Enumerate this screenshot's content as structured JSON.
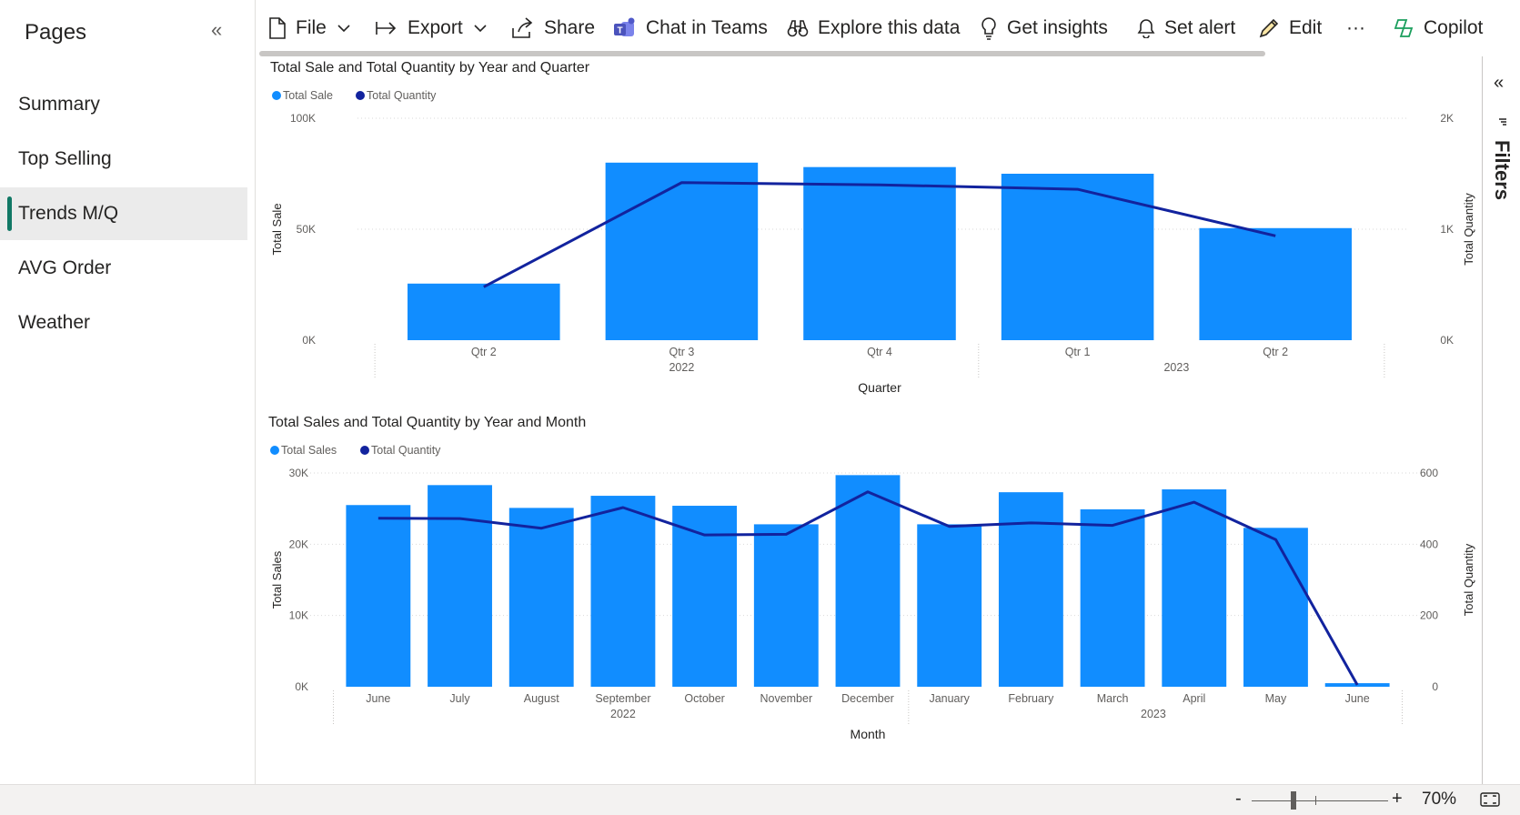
{
  "pages": {
    "title": "Pages",
    "items": [
      {
        "label": "Summary",
        "active": false
      },
      {
        "label": "Top Selling",
        "active": false
      },
      {
        "label": "Trends M/Q",
        "active": true
      },
      {
        "label": "AVG Order",
        "active": false
      },
      {
        "label": "Weather",
        "active": false
      }
    ]
  },
  "toolbar": {
    "file": "File",
    "export": "Export",
    "share": "Share",
    "teams": "Chat in Teams",
    "explore": "Explore this data",
    "insights": "Get insights",
    "alert": "Set alert",
    "edit": "Edit",
    "more": "···",
    "copilot": "Copilot"
  },
  "filters_pane": {
    "label": "Filters"
  },
  "statusbar": {
    "zoom_minus": "-",
    "zoom_plus": "+",
    "zoom": "70%",
    "zoom_level": 0.7
  },
  "colors": {
    "bar": "#118DFF",
    "line": "#12239E"
  },
  "chart_data": [
    {
      "type": "bar",
      "title": "Total Sale and Total Quantity by Year and Quarter",
      "legend": [
        "Total Sale",
        "Total Quantity"
      ],
      "legend_position": "top-left",
      "categories": [
        "Qtr 2",
        "Qtr 3",
        "Qtr 4",
        "Qtr 1",
        "Qtr 2"
      ],
      "groups": [
        {
          "label": "2022",
          "span": 3
        },
        {
          "label": "2023",
          "span": 2
        }
      ],
      "xlabel": "Quarter",
      "ylabel": "Total Sale",
      "y2label": "Total Quantity",
      "ylim": [
        0,
        100000
      ],
      "y2lim": [
        0,
        2000
      ],
      "yticks": [
        "0K",
        "50K",
        "100K"
      ],
      "y2ticks": [
        "0K",
        "1K",
        "2K"
      ],
      "series": [
        {
          "name": "Total Sale",
          "kind": "bar",
          "values": [
            25500,
            80000,
            78000,
            75000,
            50500
          ]
        },
        {
          "name": "Total Quantity",
          "kind": "line",
          "axis": "right",
          "values": [
            480,
            1420,
            1400,
            1360,
            940
          ]
        }
      ],
      "grid": true
    },
    {
      "type": "bar",
      "title": "Total Sales and Total Quantity by Year and Month",
      "legend": [
        "Total Sales",
        "Total Quantity"
      ],
      "legend_position": "top-left",
      "categories": [
        "June",
        "July",
        "August",
        "September",
        "October",
        "November",
        "December",
        "January",
        "February",
        "March",
        "April",
        "May",
        "June"
      ],
      "groups": [
        {
          "label": "2022",
          "span": 7
        },
        {
          "label": "2023",
          "span": 6
        }
      ],
      "xlabel": "Month",
      "ylabel": "Total Sales",
      "y2label": "Total Quantity",
      "ylim": [
        0,
        30000
      ],
      "y2lim": [
        0,
        600
      ],
      "yticks": [
        "0K",
        "10K",
        "20K",
        "30K"
      ],
      "y2ticks": [
        "0",
        "200",
        "400",
        "600"
      ],
      "series": [
        {
          "name": "Total Sales",
          "kind": "bar",
          "values": [
            25500,
            28300,
            25100,
            26800,
            25400,
            22800,
            29700,
            22800,
            27300,
            24900,
            27700,
            22300,
            500
          ]
        },
        {
          "name": "Total Quantity",
          "kind": "line",
          "axis": "right",
          "values": [
            473,
            472,
            445,
            503,
            426,
            428,
            547,
            450,
            460,
            453,
            518,
            413,
            5
          ]
        }
      ],
      "grid": true
    }
  ]
}
